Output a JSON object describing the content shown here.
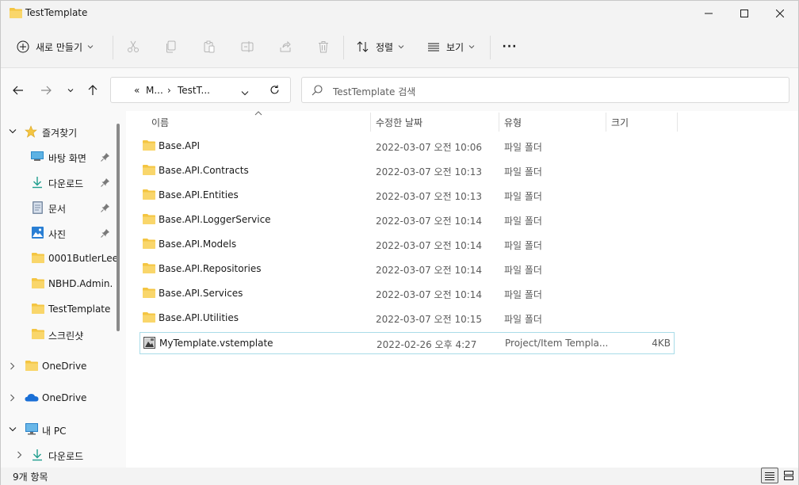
{
  "window": {
    "title": "TestTemplate"
  },
  "toolbar": {
    "new_label": "새로 만들기",
    "sort_label": "정렬",
    "view_label": "보기",
    "more_label": "···"
  },
  "address": {
    "overflow": "«",
    "crumb1": "M...",
    "crumb2": "TestT...",
    "separator": "›"
  },
  "search": {
    "placeholder": "TestTemplate 검색"
  },
  "sidebar": {
    "items": [
      {
        "label": "즐겨찾기",
        "icon": "star-icon"
      },
      {
        "label": "바탕 화면",
        "icon": "desktop-icon",
        "pinned": true
      },
      {
        "label": "다운로드",
        "icon": "download-icon",
        "pinned": true
      },
      {
        "label": "문서",
        "icon": "document-icon",
        "pinned": true
      },
      {
        "label": "사진",
        "icon": "picture-icon",
        "pinned": true
      },
      {
        "label": "0001ButlerLee",
        "icon": "folder-icon"
      },
      {
        "label": "NBHD.Admin.A",
        "icon": "folder-icon"
      },
      {
        "label": "TestTemplate",
        "icon": "folder-icon"
      },
      {
        "label": "스크린샷",
        "icon": "folder-icon"
      },
      {
        "label": "OneDrive",
        "icon": "folder-icon"
      },
      {
        "label": "OneDrive",
        "icon": "cloud-icon"
      },
      {
        "label": "내 PC",
        "icon": "pc-icon"
      },
      {
        "label": "다운로드",
        "icon": "download-icon"
      }
    ]
  },
  "columns": {
    "name": "이름",
    "date": "수정한 날짜",
    "type": "유형",
    "size": "크기"
  },
  "files": [
    {
      "name": "Base.API",
      "date": "2022-03-07 오전 10:06",
      "type": "파일 폴더",
      "size": ""
    },
    {
      "name": "Base.API.Contracts",
      "date": "2022-03-07 오전 10:13",
      "type": "파일 폴더",
      "size": ""
    },
    {
      "name": "Base.API.Entities",
      "date": "2022-03-07 오전 10:13",
      "type": "파일 폴더",
      "size": ""
    },
    {
      "name": "Base.API.LoggerService",
      "date": "2022-03-07 오전 10:14",
      "type": "파일 폴더",
      "size": ""
    },
    {
      "name": "Base.API.Models",
      "date": "2022-03-07 오전 10:14",
      "type": "파일 폴더",
      "size": ""
    },
    {
      "name": "Base.API.Repositories",
      "date": "2022-03-07 오전 10:14",
      "type": "파일 폴더",
      "size": ""
    },
    {
      "name": "Base.API.Services",
      "date": "2022-03-07 오전 10:14",
      "type": "파일 폴더",
      "size": ""
    },
    {
      "name": "Base.API.Utilities",
      "date": "2022-03-07 오전 10:15",
      "type": "파일 폴더",
      "size": ""
    },
    {
      "name": "MyTemplate.vstemplate",
      "date": "2022-02-26 오후 4:27",
      "type": "Project/Item Templa...",
      "size": "4KB"
    }
  ],
  "status": {
    "count": "9개 항목"
  },
  "colors": {
    "folder": "#f4c542",
    "accent": "#0067c0",
    "selected_border": "#a9dce8"
  }
}
